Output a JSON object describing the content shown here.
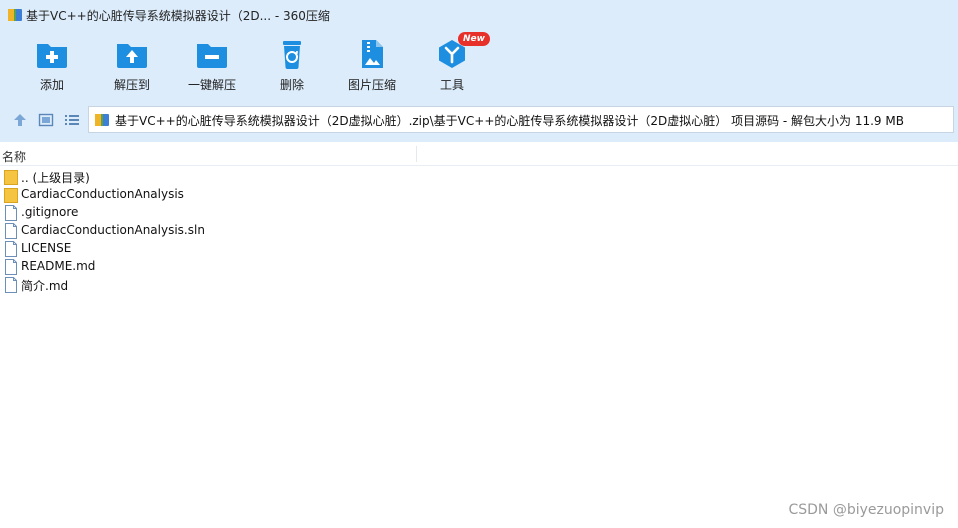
{
  "window": {
    "title": "基于VC++的心脏传导系统模拟器设计（2D... - 360压缩"
  },
  "toolbar": {
    "items": [
      {
        "label": "添加",
        "icon": "add-folder-icon"
      },
      {
        "label": "解压到",
        "icon": "extract-to-icon"
      },
      {
        "label": "一键解压",
        "icon": "one-click-extract-icon"
      },
      {
        "label": "删除",
        "icon": "trash-icon"
      },
      {
        "label": "图片压缩",
        "icon": "image-compress-icon"
      },
      {
        "label": "工具",
        "icon": "tools-icon",
        "badge": "New"
      }
    ]
  },
  "addressbar": {
    "path": "基于VC++的心脏传导系统模拟器设计（2D虚拟心脏）.zip\\基于VC++的心脏传导系统模拟器设计（2D虚拟心脏） 项目源码 - 解包大小为 11.9 MB"
  },
  "list": {
    "column_name": "名称",
    "items": [
      {
        "name": ".. (上级目录)",
        "type": "folder"
      },
      {
        "name": "CardiacConductionAnalysis",
        "type": "folder"
      },
      {
        "name": ".gitignore",
        "type": "file"
      },
      {
        "name": "CardiacConductionAnalysis.sln",
        "type": "file"
      },
      {
        "name": "LICENSE",
        "type": "file"
      },
      {
        "name": "README.md",
        "type": "file"
      },
      {
        "name": "简介.md",
        "type": "file"
      }
    ]
  },
  "watermark": "CSDN @biyezuopinvip",
  "colors": {
    "chrome_bg": "#dcecfb",
    "icon_blue": "#1e8fe0",
    "folder_yellow": "#f5c542",
    "badge_red": "#e8302a"
  }
}
